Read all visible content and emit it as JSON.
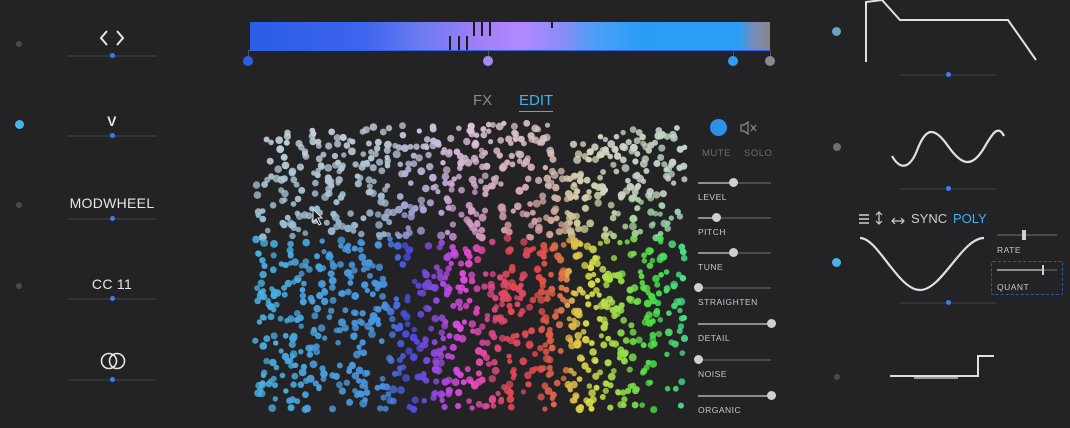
{
  "left_mods": [
    {
      "label": "",
      "icon": "code-brackets-icon",
      "active": false
    },
    {
      "label": "V",
      "icon": "",
      "active": true
    },
    {
      "label": "MODWHEEL",
      "icon": "",
      "active": false
    },
    {
      "label": "CC 11",
      "icon": "",
      "active": false
    },
    {
      "label": "",
      "icon": "double-circle-icon",
      "active": false
    }
  ],
  "tabs": {
    "fx": "FX",
    "edit": "EDIT",
    "selected": "EDIT"
  },
  "voice": {
    "mute": "MUTE",
    "solo": "SOLO",
    "speaker_icon": "speaker-mute-icon",
    "color": "#2e8fe6"
  },
  "sliders": [
    {
      "label": "LEVEL",
      "value": 0.48
    },
    {
      "label": "PITCH",
      "value": 0.25
    },
    {
      "label": "TUNE",
      "value": 0.48
    },
    {
      "label": "STRAIGHTEN",
      "value": 0.0
    },
    {
      "label": "DETAIL",
      "value": 1.0
    },
    {
      "label": "NOISE",
      "value": 0.0
    },
    {
      "label": "ORGANIC",
      "value": 1.0
    }
  ],
  "gradient_stops": [
    {
      "color": "#2b5de6",
      "position": 0.0
    },
    {
      "color": "#a88af7",
      "position": 0.46
    },
    {
      "color": "#2b9ff5",
      "position": 0.93
    },
    {
      "color": "#8a8a8e",
      "position": 1.0
    }
  ],
  "lfo": {
    "menu_icon": "menu-icon",
    "vertical_icon": "vertical-arrows-icon",
    "horizontal_icon": "horizontal-arrows-icon",
    "sync": "SYNC",
    "poly": "POLY",
    "rate_label": "RATE",
    "rate_value": 0.42,
    "quant_label": "QUANT",
    "quant_value": 0.75
  },
  "right_mods": [
    {
      "shape": "envelope",
      "active": true
    },
    {
      "shape": "sine-warped",
      "active": false
    },
    {
      "shape": "sine",
      "active": true
    },
    {
      "shape": "step",
      "active": false
    }
  ],
  "colors": {
    "accent": "#3fb0f0",
    "bg": "#232325",
    "knob": "#3a7ef0"
  }
}
